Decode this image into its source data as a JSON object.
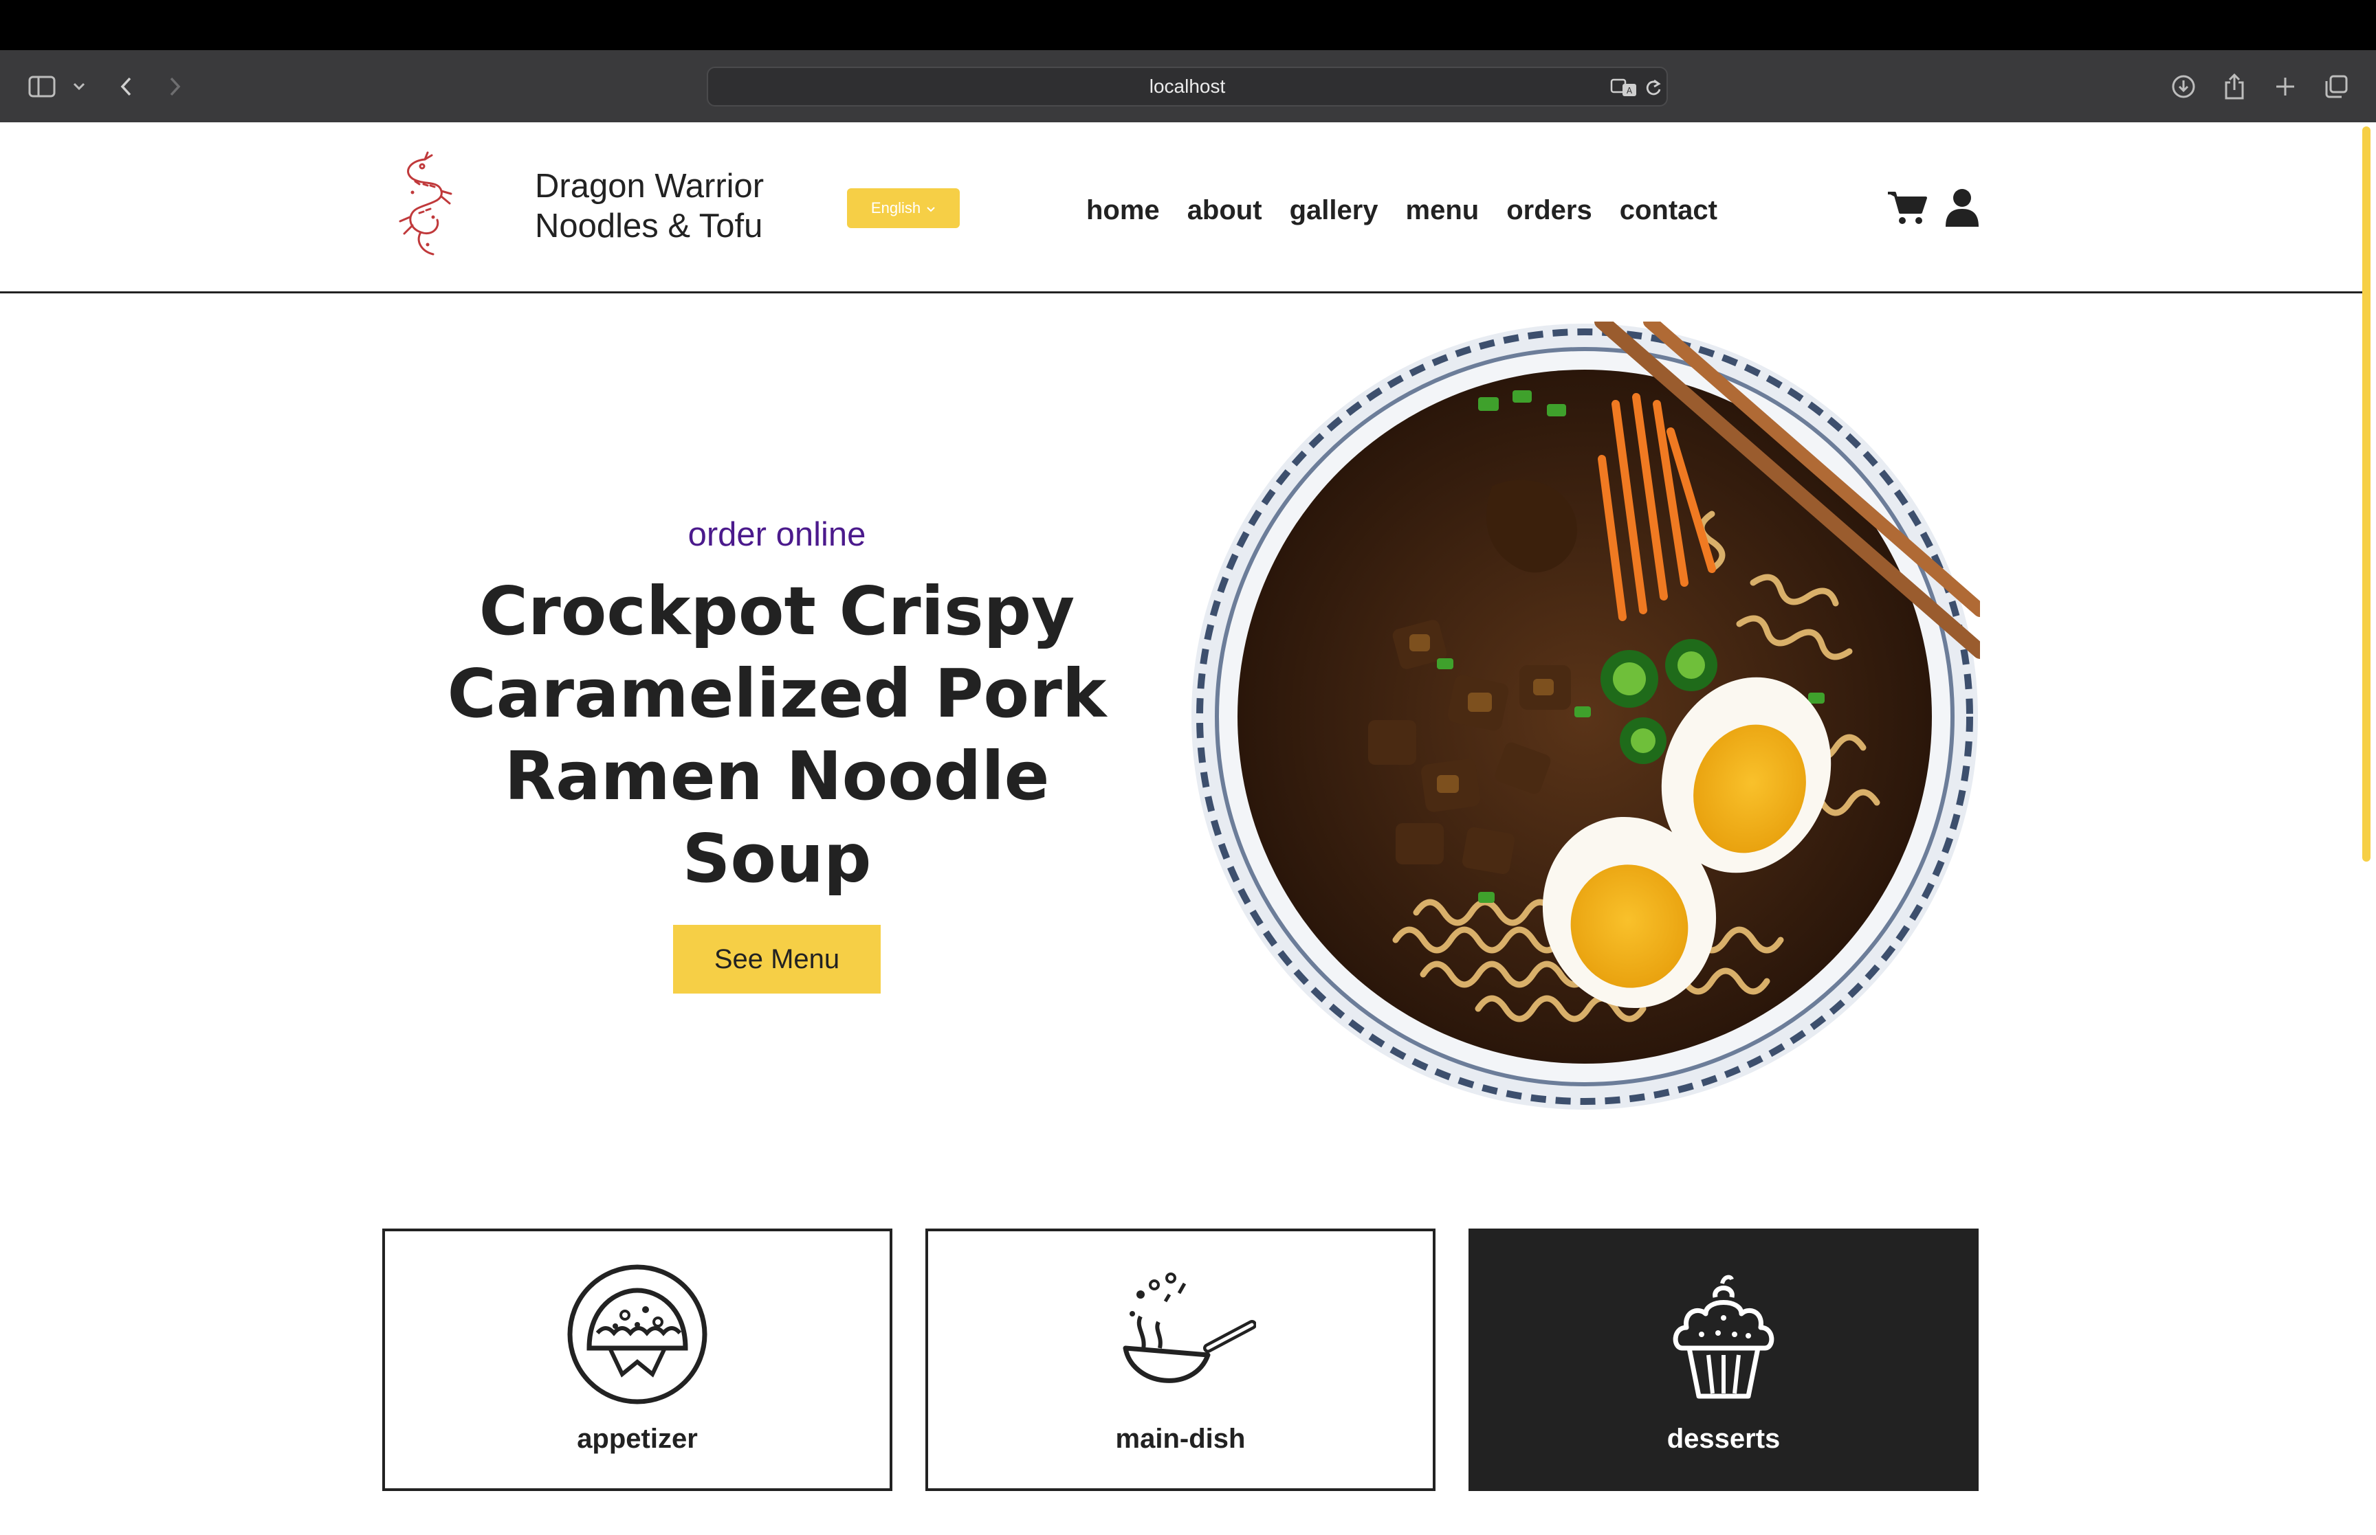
{
  "browser": {
    "url": "localhost",
    "icons": [
      "sidebar-icon",
      "chevron-down-icon",
      "back-icon",
      "forward-icon",
      "translate-icon",
      "reload-icon",
      "download-icon",
      "share-icon",
      "new-tab-icon",
      "tabs-overview-icon"
    ]
  },
  "header": {
    "brand_line1": "Dragon Warrior",
    "brand_line2": "Noodles & Tofu",
    "language": "English",
    "nav": [
      "home",
      "about",
      "gallery",
      "menu",
      "orders",
      "contact"
    ],
    "icons": [
      "cart-icon",
      "user-icon"
    ]
  },
  "hero": {
    "eyebrow": "order online",
    "title_line1": "Crockpot Crispy",
    "title_line2": "Caramelized Pork",
    "title_line3": "Ramen Noodle Soup",
    "cta": "See Menu"
  },
  "categories": [
    {
      "label": "appetizer",
      "icon": "taco-icon",
      "active": false
    },
    {
      "label": "main-dish",
      "icon": "wok-icon",
      "active": false
    },
    {
      "label": "desserts",
      "icon": "cupcake-icon",
      "active": true
    }
  ],
  "colors": {
    "accent": "#f6cf46",
    "eyebrow": "#4b1a8c",
    "dark": "#222222",
    "chrome": "#3a3a3c"
  }
}
